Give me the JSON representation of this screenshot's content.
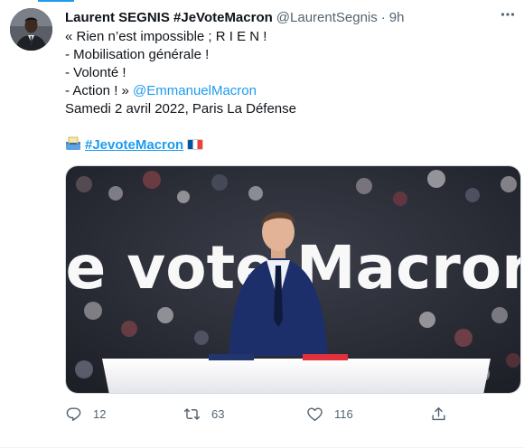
{
  "tweet": {
    "author_name": "Laurent SEGNIS #JeVoteMacron",
    "author_handle": "@LaurentSegnis",
    "separator": "·",
    "timestamp": "9h",
    "lines": {
      "l1": "« Rien n’est impossible ; R I E N !",
      "l2": "- Mobilisation générale !",
      "l3": "- Volonté !",
      "l4_prefix": "- Action ! » ",
      "l4_mention": "@EmmanuelMacron",
      "l5": "Samedi 2 avril 2022, Paris La Défense"
    },
    "hashtag": "#JevoteMacron",
    "image_text": "Je vote Macron",
    "icons": {
      "ballot": "ballot-box-icon",
      "flag": "france-flag-icon",
      "more": "more-icon"
    }
  },
  "actions": {
    "reply_count": "12",
    "retweet_count": "63",
    "like_count": "116"
  },
  "colors": {
    "accent": "#1d9bf0",
    "secondary_text": "#536471",
    "primary_text": "#0f1419",
    "image_blue_bg": "#122a5e",
    "podium_white": "#f4f4f6",
    "flag_blue": "#0055a4",
    "flag_red": "#ef4135"
  }
}
